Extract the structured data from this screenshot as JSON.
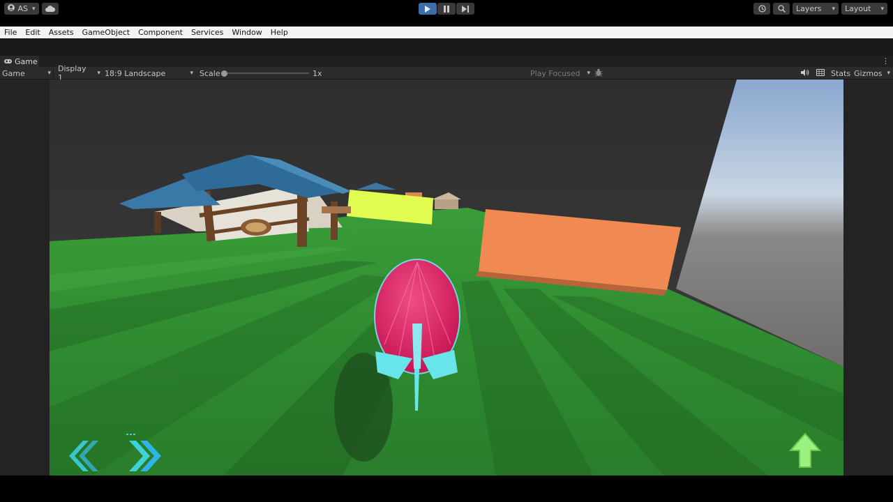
{
  "menu": [
    "File",
    "Edit",
    "Assets",
    "GameObject",
    "Component",
    "Services",
    "Window",
    "Help"
  ],
  "toolbar": {
    "account_label": "AS",
    "layers_label": "Layers",
    "layout_label": "Layout"
  },
  "tab": {
    "label": "Game"
  },
  "game_view": {
    "mode_label": "Game",
    "display_label": "Display 1",
    "aspect_label": "18:9 Landscape",
    "scale_label": "Scale",
    "scale_value": "1x",
    "play_mode_label": "Play Focused",
    "stats_label": "Stats",
    "gizmos_label": "Gizmos"
  },
  "colors": {
    "play_active": "#3d6ea8",
    "ground_green": "#3aa93a",
    "creature_pink": "#e0185e",
    "creature_cyan": "#67e5ea",
    "orange_wall": "#f08a52",
    "yellow_wall": "#e1fb50",
    "arrow_cyan": "#39c6cc",
    "arrow_up_green": "#9bf07f"
  },
  "icons": {
    "play": "play-icon",
    "pause": "pause-icon",
    "step": "step-icon",
    "history": "history-icon",
    "search": "search-icon",
    "cloud": "cloud-icon",
    "account": "account-icon",
    "mute": "speaker-icon",
    "bug": "bug-icon"
  }
}
